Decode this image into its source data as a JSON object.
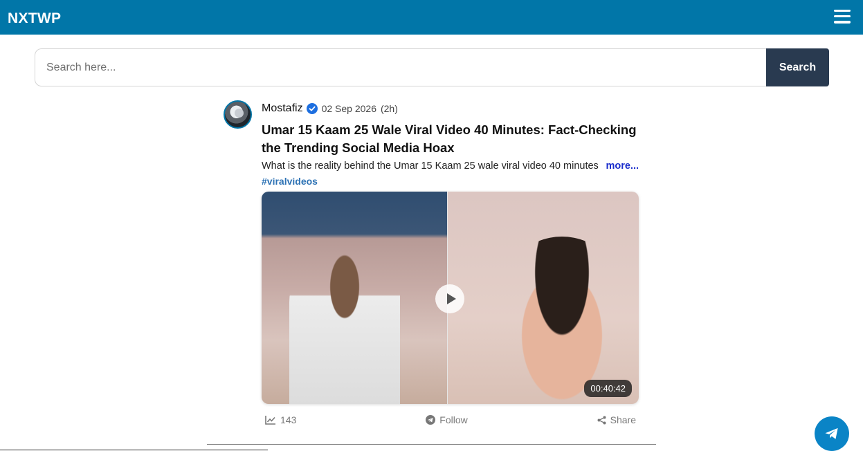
{
  "header": {
    "brand": "NXTWP",
    "menu_icon": "hamburger-menu-icon"
  },
  "search": {
    "placeholder": "Search here...",
    "button_label": "Search"
  },
  "post": {
    "author": "Mostafiz",
    "verified_icon": "verified-badge-icon",
    "date": "02 Sep 2026",
    "ago": "(2h)",
    "title": "Umar 15 Kaam 25 Wale Viral Video 40 Minutes: Fact-Checking the Trending Social Media Hoax",
    "excerpt": "What is the reality behind the Umar 15 Kaam 25 wale viral video 40 minutes",
    "more_label": "more...",
    "hashtag": "#viralvideos",
    "video_duration": "00:40:42",
    "views": "143",
    "follow_label": "Follow",
    "share_label": "Share"
  },
  "floating": {
    "telegram_icon": "telegram-icon"
  },
  "colors": {
    "header_bg": "#0176a8",
    "search_btn_bg": "#293a50",
    "link_more": "#1a2dcc",
    "hashtag": "#2e73b5",
    "telegram_bg": "#0a84c6"
  }
}
